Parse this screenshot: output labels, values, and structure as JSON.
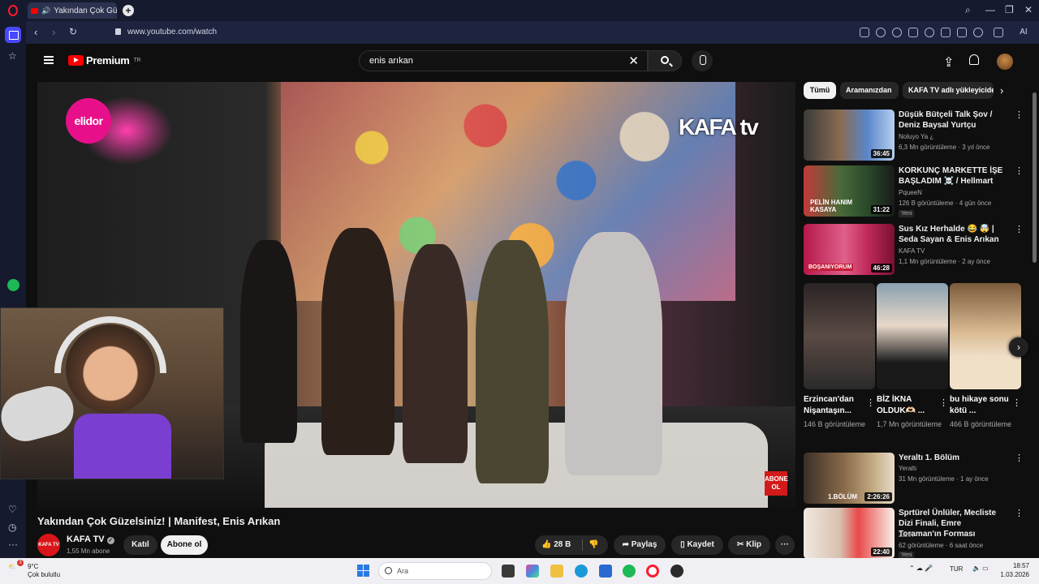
{
  "browser": {
    "tab_title": "Yakından Çok Güzelsiniz",
    "url": "www.youtube.com/watch",
    "ai_label": "AI"
  },
  "youtube": {
    "logo_text": "Premium",
    "region": "TR",
    "search_value": "enis arıkan"
  },
  "video": {
    "overlay_brand": "elidor",
    "overlay_channel_logo": "KAFA tv",
    "overlay_subscribe_badge": "ABONE OL",
    "title": "Yakından Çok Güzelsiniz! | Manifest, Enis Arıkan",
    "channel_avatar_text": "KAFA TV",
    "channel_name": "KAFA TV",
    "subscribers": "1,55 Mn abone",
    "join_label": "Katıl",
    "subscribe_label": "Abone ol",
    "likes": "28 B",
    "share_label": "Paylaş",
    "save_label": "Kaydet",
    "clip_label": "Klip"
  },
  "chips": [
    "Tümü",
    "Aramanızdan",
    "KAFA TV adlı yükleyiciden"
  ],
  "recommendations": [
    {
      "title": "Düşük Bütçeli Talk Şov / Deniz Baysal Yurtçu",
      "channel": "Noluyo Ya ¿",
      "meta": "6,3 Mn görüntüleme · 3 yıl önce",
      "duration": "36:45",
      "badge": ""
    },
    {
      "title": "KORKUNÇ MARKETTE İŞE BAŞLADIM ☠️ / Hellmart",
      "channel": "PqueeN",
      "meta": "126 B görüntüleme · 4 gün önce",
      "duration": "31:22",
      "badge": "Yeni",
      "thumb_text": "PELİN HANIM KASAYA"
    },
    {
      "title": "Sus Kız Herhalde 😂 🤯 | Seda Sayan & Enis Arıkan",
      "channel": "KAFA TV",
      "meta": "1,1 Mn görüntüleme · 2 ay önce",
      "duration": "46:28",
      "badge": "",
      "thumb_text": "BOŞANIYORUM"
    },
    {
      "title": "Yeraltı 1. Bölüm",
      "channel": "Yeraltı",
      "meta": "31 Mn görüntüleme · 1 ay önce",
      "duration": "2:26:26",
      "badge": "",
      "thumb_text": "1.BÖLÜM"
    },
    {
      "title": "Sprtürel Ünlüler, Mecliste Dizi Finali, Emre Toraman'ın Forması",
      "channel": "Zann",
      "meta": "62 görüntüleme · 6 saat önce",
      "duration": "22:40",
      "badge": "Yeni"
    }
  ],
  "shorts": [
    {
      "title": "Erzincan'dan Nişantaşın...",
      "views": "146 B görüntüleme"
    },
    {
      "title": "BİZ İKNA OLDUK🫶🏻 ...",
      "views": "1,7 Mn görüntüleme"
    },
    {
      "title": "bu hikaye sonu kötü ...",
      "views": "466 B görüntüleme"
    }
  ],
  "taskbar": {
    "temp": "9°C",
    "weather": "Çok bulutlu",
    "notif_count": "3",
    "search_placeholder": "Ara",
    "lang": "TUR",
    "time": "18:57",
    "date": "1.03.2026"
  },
  "colors": {
    "yt_red": "#ff0000",
    "opera_red": "#ff1b2d",
    "page_bg": "#0f0f0f",
    "browser_chrome": "#161a2e"
  }
}
